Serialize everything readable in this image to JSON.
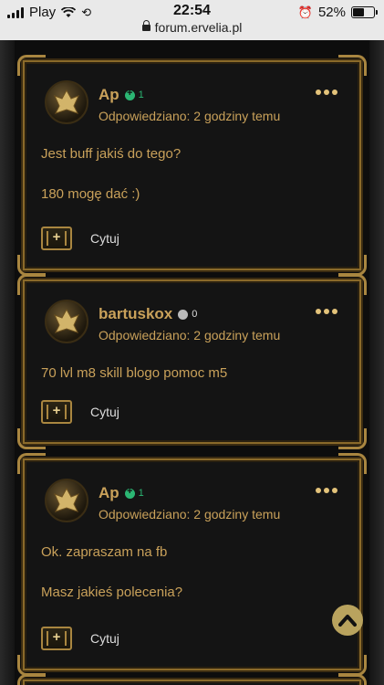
{
  "status": {
    "carrier": "Play",
    "time": "22:54",
    "url": "forum.ervelia.pl",
    "battery": "52%",
    "battery_level": 0.52
  },
  "posts": [
    {
      "author": "Ap",
      "reputation": "1",
      "reputation_type": "positive",
      "timestamp": "Odpowiedziano: 2 godziny temu",
      "lines": [
        "Jest buff jakiś do tego?",
        "180 mogę dać :)"
      ],
      "quote_label": "Cytuj"
    },
    {
      "author": "bartuskox",
      "reputation": "0",
      "reputation_type": "neutral",
      "timestamp": "Odpowiedziano: 2 godziny temu",
      "lines": [
        "70 lvl m8 skill blogo pomoc m5"
      ],
      "quote_label": "Cytuj"
    },
    {
      "author": "Ap",
      "reputation": "1",
      "reputation_type": "positive",
      "timestamp": "Odpowiedziano: 2 godziny temu",
      "lines": [
        "Ok. zapraszam na fb",
        "Masz jakieś polecenia?"
      ],
      "quote_label": "Cytuj"
    }
  ],
  "icons": {
    "quote": "quote-plus-icon",
    "more": "more-dots-icon",
    "scroll": "chevron-up-icon"
  },
  "colors": {
    "accent": "#c9a15a",
    "positive": "#2bb673",
    "frame": "#a98640"
  }
}
